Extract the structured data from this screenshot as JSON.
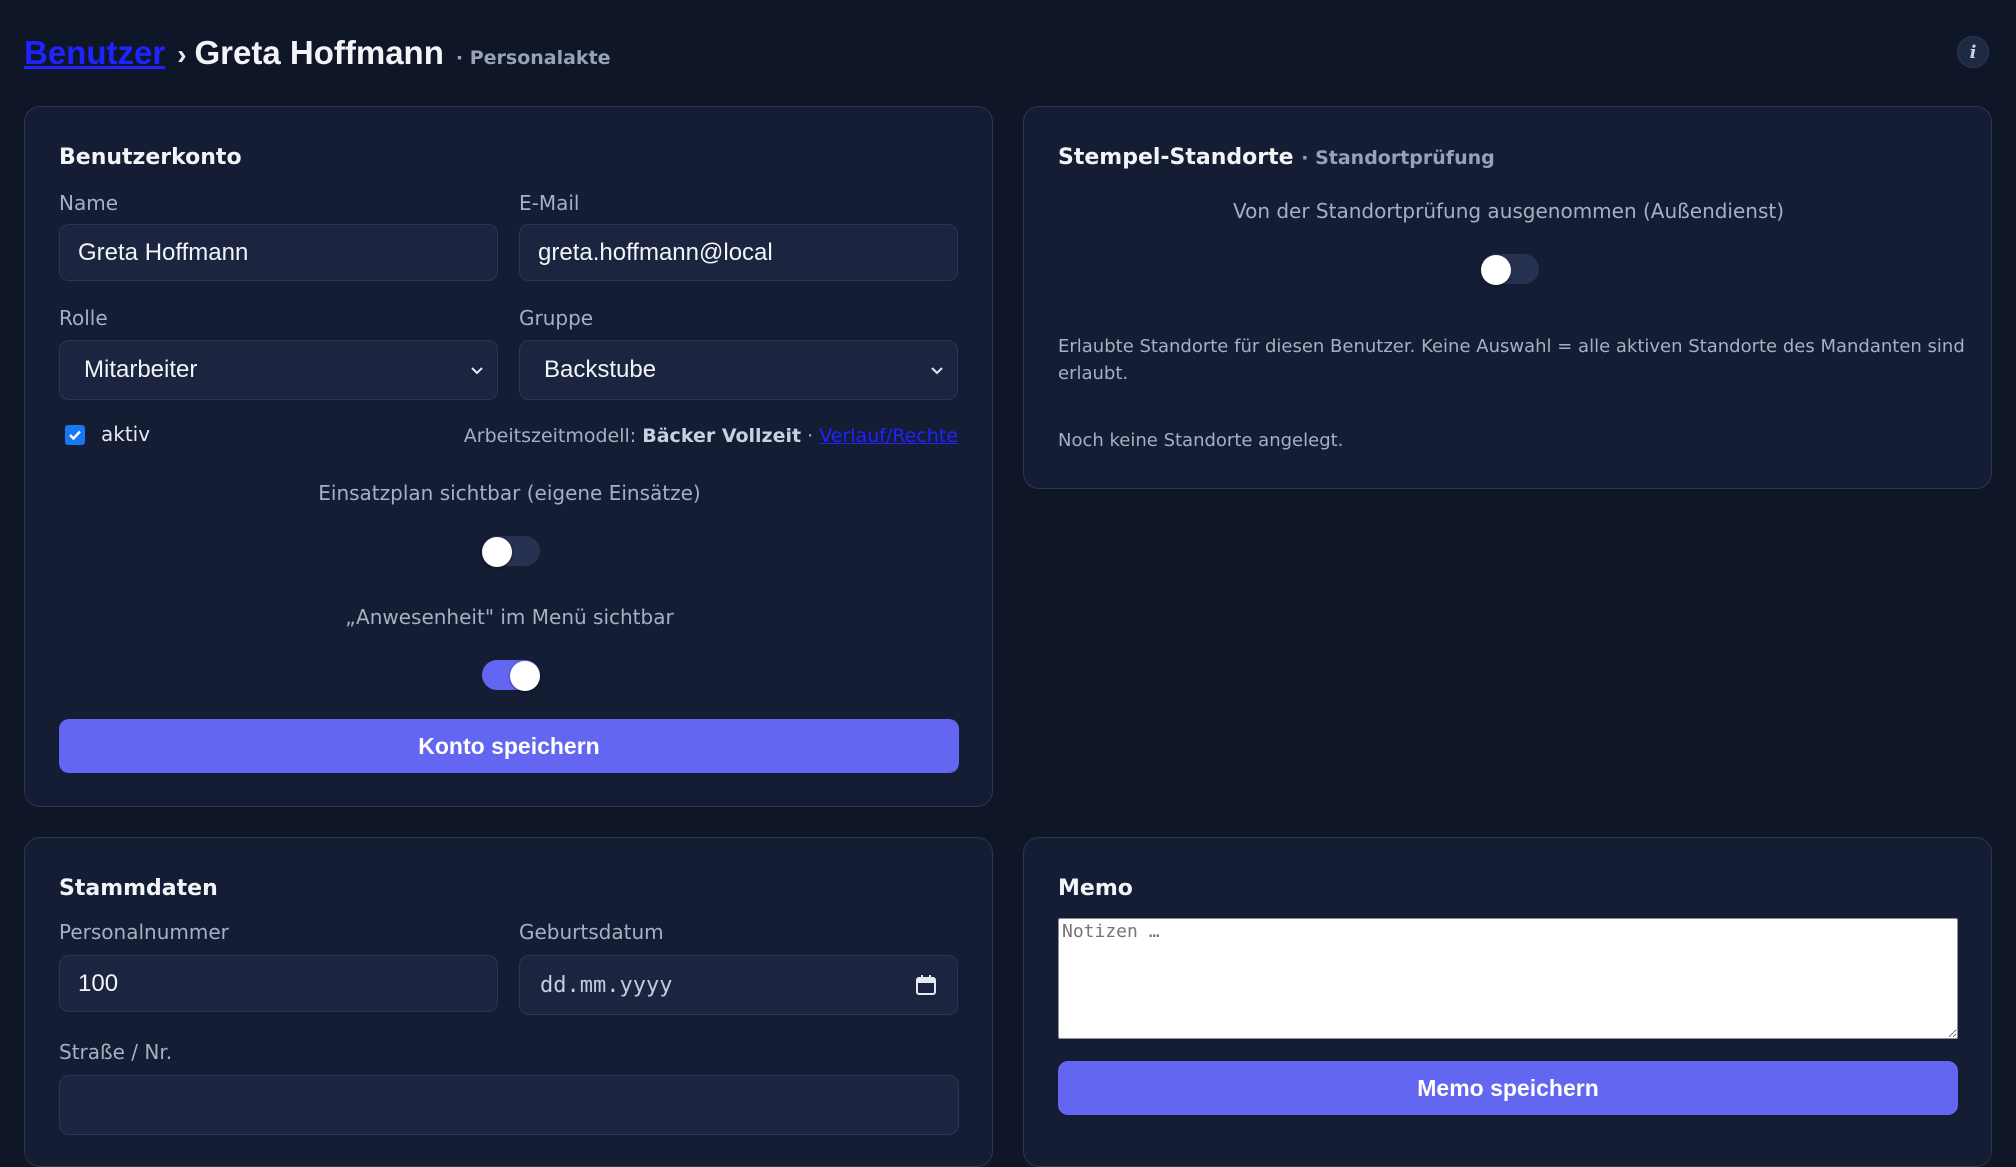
{
  "breadcrumb": {
    "parent": "Benutzer",
    "separator": "›",
    "current": "Greta Hoffmann",
    "subtitle": "· Personalakte"
  },
  "info_button": {
    "label": "i"
  },
  "account": {
    "title": "Benutzerkonto",
    "name_label": "Name",
    "name_value": "Greta Hoffmann",
    "email_label": "E-Mail",
    "email_value": "greta.hoffmann@local",
    "role_label": "Rolle",
    "role_value": "Mitarbeiter",
    "group_label": "Gruppe",
    "group_value": "Backstube",
    "active_label": "aktiv",
    "active_checked": true,
    "worktime_prefix": "Arbeitszeitmodell:",
    "worktime_value": "Bäcker Vollzeit",
    "worktime_sep": "·",
    "worktime_link": "Verlauf/Rechte",
    "schedule_label": "Einsatzplan sichtbar (eigene Einsätze)",
    "schedule_on": false,
    "attendance_label": "„Anwesenheit\" im Menü sichtbar",
    "attendance_on": true,
    "save_button": "Konto speichern"
  },
  "locations": {
    "title": "Stempel-Standorte",
    "subtitle": "· Standortprüfung",
    "exempt_label": "Von der Standortprüfung ausgenommen (Außendienst)",
    "exempt_on": false,
    "description": "Erlaubte Standorte für diesen Benutzer. Keine Auswahl = alle aktiven Standorte des Mandanten sind erlaubt.",
    "empty_text": "Noch keine Standorte angelegt."
  },
  "master_data": {
    "title": "Stammdaten",
    "personnel_label": "Personalnummer",
    "personnel_value": "100",
    "birthdate_label": "Geburtsdatum",
    "birthdate_placeholder": "dd.mm.yyyy",
    "street_label": "Straße / Nr.",
    "street_value": ""
  },
  "memo": {
    "title": "Memo",
    "placeholder": "Notizen …",
    "save_button": "Memo speichern"
  },
  "colors": {
    "background": "#0f1628",
    "card": "#141d33",
    "accent": "#6366f1",
    "link": "#1f23ff"
  }
}
